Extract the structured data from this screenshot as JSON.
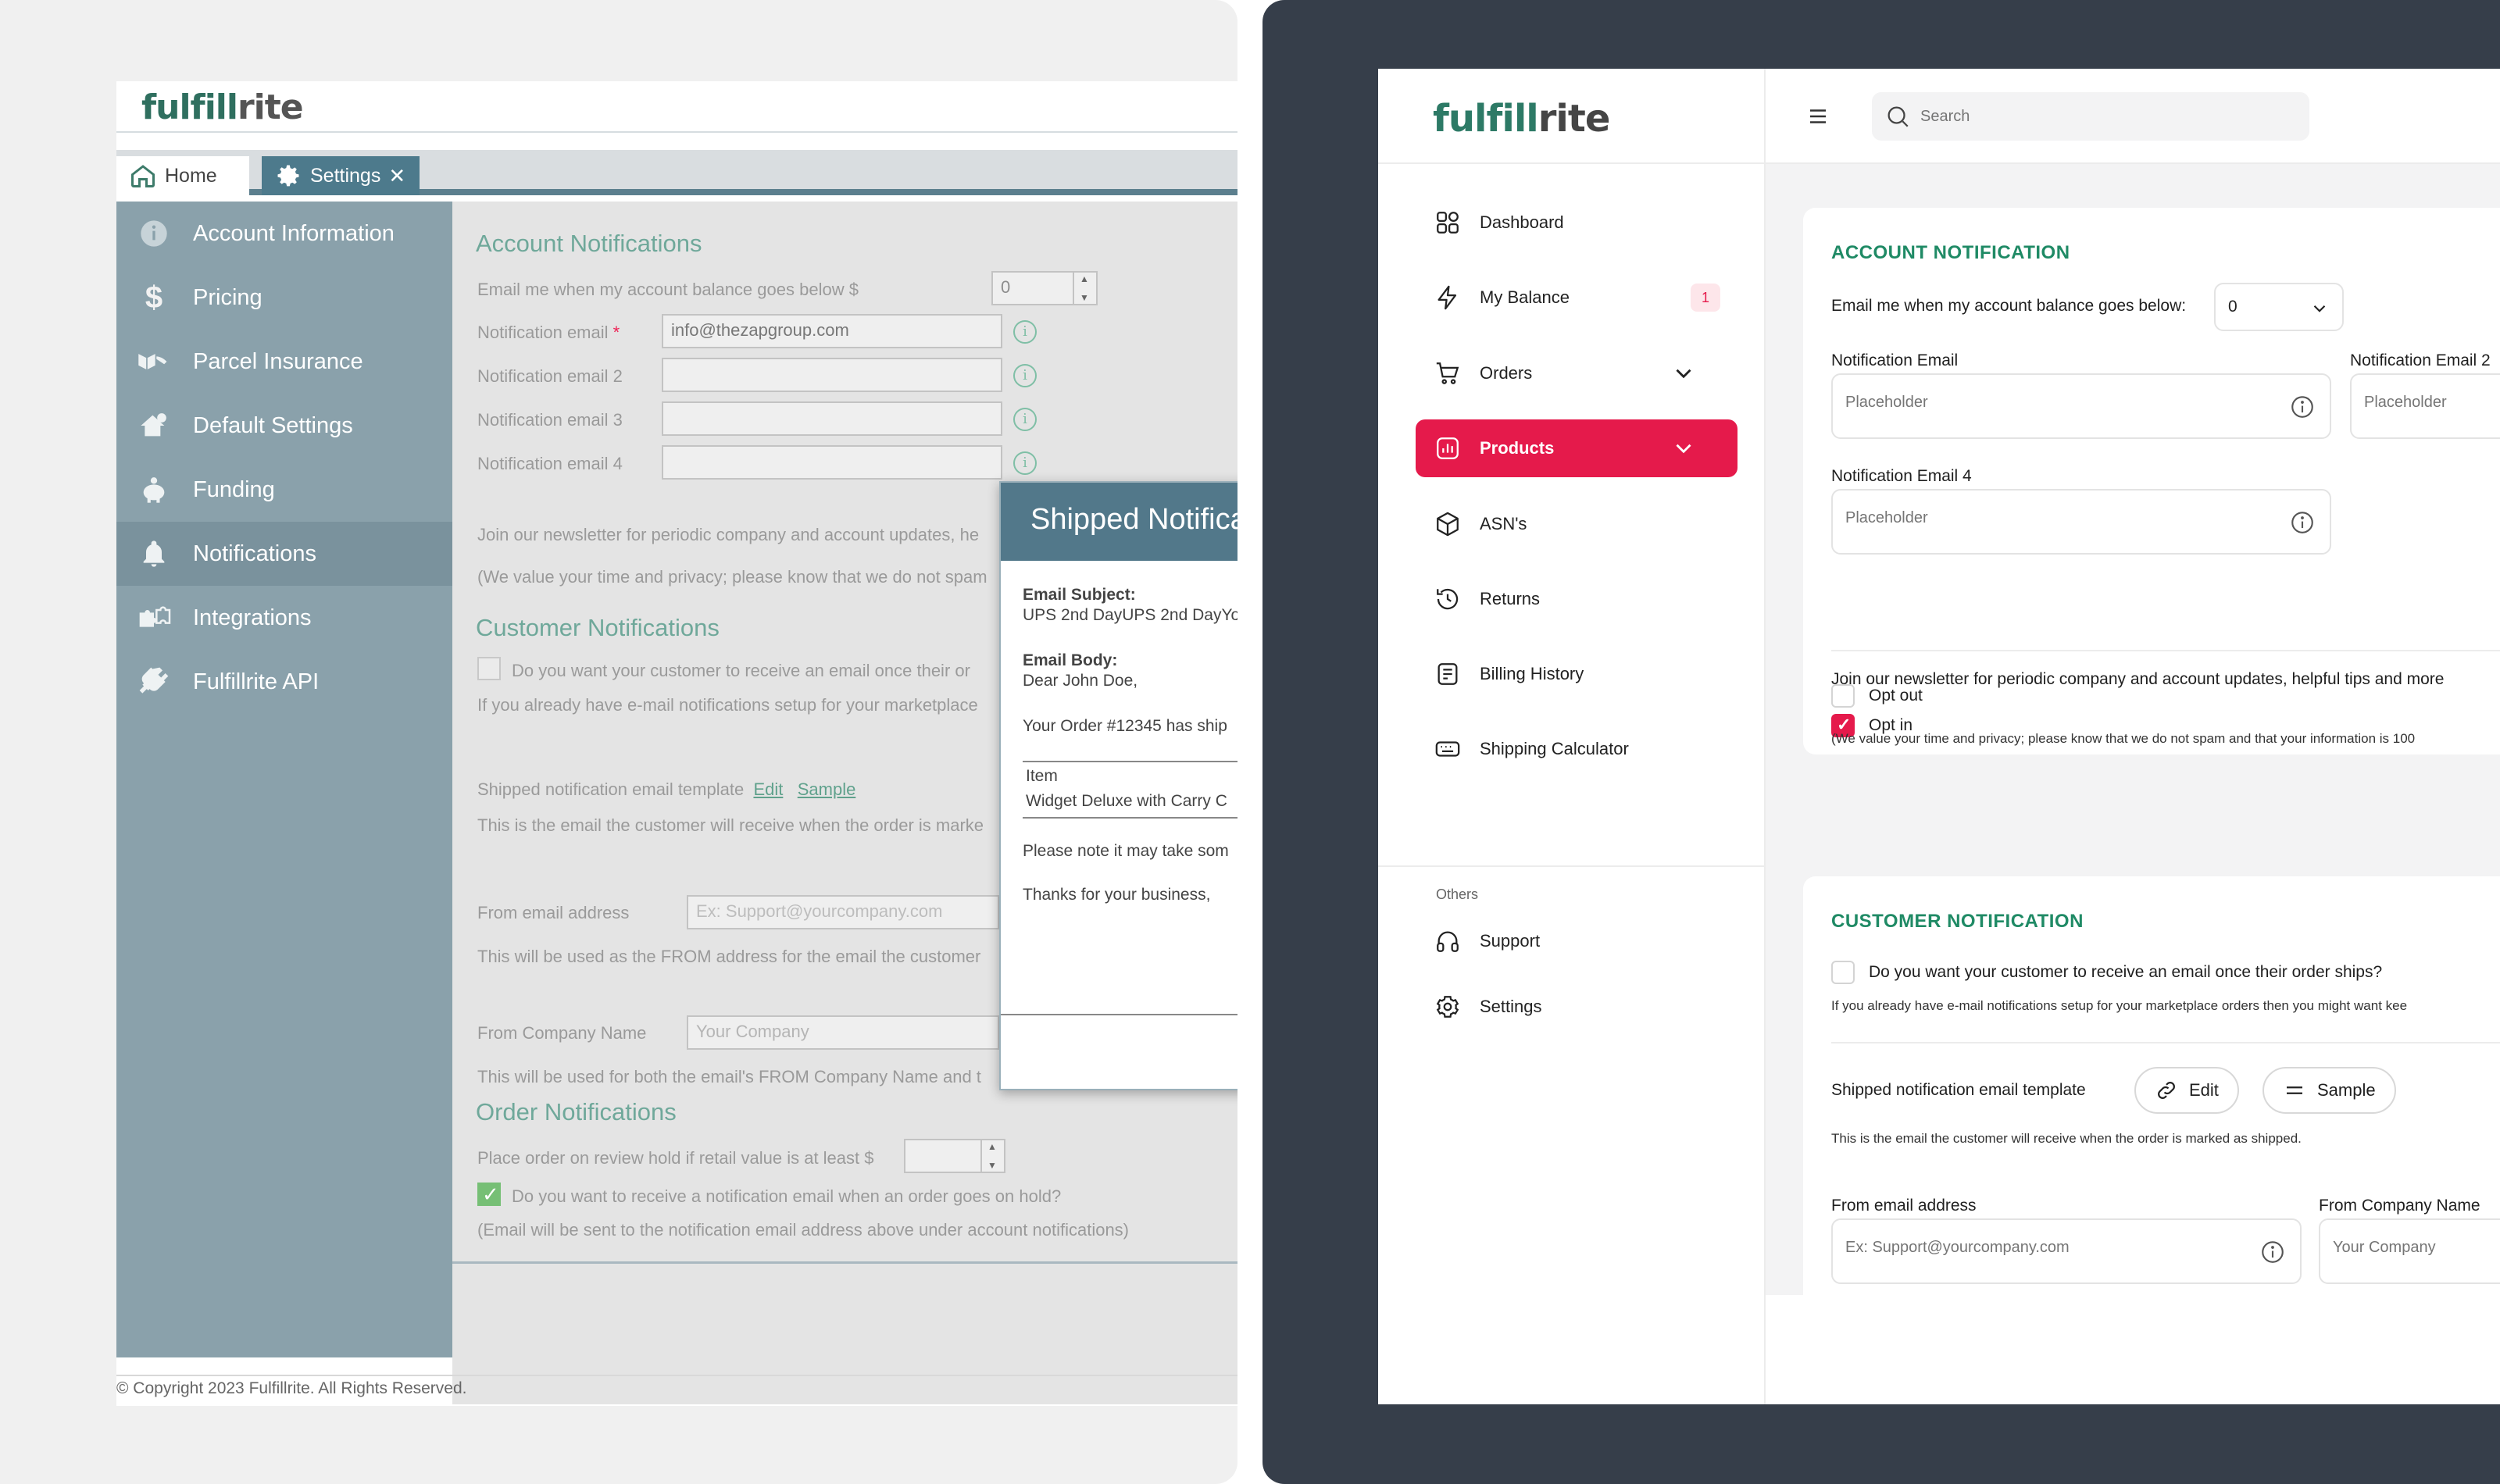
{
  "old_ui": {
    "logo": {
      "a": "fulfill",
      "b": "rite"
    },
    "tabs": {
      "home": "Home",
      "settings": "Settings"
    },
    "sidebar": [
      {
        "label": "Account Information",
        "icon": "info-icon"
      },
      {
        "label": "Pricing",
        "icon": "dollar-icon"
      },
      {
        "label": "Parcel Insurance",
        "icon": "parcel-insurance-icon"
      },
      {
        "label": "Default Settings",
        "icon": "house-gear-icon"
      },
      {
        "label": "Funding",
        "icon": "piggy-bank-icon"
      },
      {
        "label": "Notifications",
        "icon": "bell-icon"
      },
      {
        "label": "Integrations",
        "icon": "puzzle-icon"
      },
      {
        "label": "Fulfillrite API",
        "icon": "plug-icon"
      }
    ],
    "account": {
      "title": "Account Notifications",
      "balance_label": "Email me when my account balance goes below $",
      "balance_value": "0",
      "email_label": "Notification email",
      "email_required": "*",
      "email_value": "info@thezapgroup.com",
      "email2_label": "Notification email 2",
      "email3_label": "Notification email 3",
      "email4_label": "Notification email 4",
      "newsletter": "Join our newsletter for periodic company and account updates, he",
      "privacy": "(We value your time and privacy; please know that we do not spam"
    },
    "customer": {
      "title": "Customer Notifications",
      "question": "Do you want your customer to receive an email once their or",
      "setup_note": "If you already have e-mail notifications setup for your marketplace",
      "template_label": "Shipped notification email template",
      "edit": "Edit",
      "sample": "Sample",
      "template_note": "This is the email the customer will receive when the order is marke",
      "from_email_label": "From email address",
      "from_email_placeholder": "Ex: Support@yourcompany.com",
      "from_email_note": "This will be used as the FROM address for the email the customer",
      "from_company_label": "From Company Name",
      "from_company_placeholder": "Your Company",
      "from_company_note": "This will be used for both the email's FROM Company Name and t"
    },
    "order": {
      "title": "Order Notifications",
      "hold_label": "Place order on review hold if retail value is at least $",
      "hold_question": "Do you want to receive a notification email when an order goes on hold?",
      "hold_note": "(Email will be sent to the notification email address above under account notifications)"
    },
    "modal": {
      "title": "Shipped Notifica",
      "subject_label": "Email Subject:",
      "subject_value": "UPS 2nd DayUPS 2nd DayYo",
      "body_label": "Email Body:",
      "greeting": "Dear John Doe,",
      "order_line": "Your Order #12345 has ship",
      "item_label": "Item",
      "item_value": "Widget Deluxe with Carry C",
      "note": "Please note it may take som",
      "thanks": "Thanks for your business,"
    },
    "footer": "© Copyright 2023 Fulfillrite. All Rights Reserved."
  },
  "new_ui": {
    "logo": {
      "a": "fulfill",
      "b": "rite"
    },
    "search_placeholder": "Search",
    "nav": [
      {
        "label": "Dashboard",
        "icon": "grid-icon"
      },
      {
        "label": "My Balance",
        "icon": "lightning-icon",
        "badge": "1"
      },
      {
        "label": "Orders",
        "icon": "cart-icon"
      },
      {
        "label": "Products",
        "icon": "chart-icon"
      },
      {
        "label": "ASN's",
        "icon": "box-icon"
      },
      {
        "label": "Returns",
        "icon": "history-icon"
      },
      {
        "label": "Billing History",
        "icon": "receipt-icon"
      },
      {
        "label": "Shipping Calculator",
        "icon": "keyboard-icon"
      }
    ],
    "nav_section": "Others",
    "nav_others": [
      {
        "label": "Support",
        "icon": "headphones-icon"
      },
      {
        "label": "Settings",
        "icon": "gear-icon"
      }
    ],
    "account": {
      "title": "ACCOUNT NOTIFICATION",
      "balance_label": "Email me when my account balance goes below:",
      "balance_value": "0",
      "email_label": "Notification Email",
      "email2_label": "Notification Email 2",
      "email4_label": "Notification Email 4",
      "placeholder": "Placeholder",
      "newsletter": "Join our newsletter for periodic company and account updates, helpful tips and more",
      "opt_in": "Opt in",
      "opt_out": "Opt out",
      "privacy": "(We value your time and privacy; please know that we do not spam and that your information is 100"
    },
    "customer": {
      "title": "CUSTOMER NOTIFICATION",
      "question": "Do you want your customer to receive an email once their order ships?",
      "setup_note": "If you already have e-mail notifications setup for your marketplace orders then you might want kee",
      "template_label": "Shipped notification email template",
      "edit": "Edit",
      "sample": "Sample",
      "template_note": "This is the email the customer will receive when the order is marked as shipped.",
      "from_email_label": "From email address",
      "from_email_placeholder": "Ex: Support@yourcompany.com",
      "from_company_label": "From Company Name",
      "from_company_placeholder": "Your Company"
    }
  },
  "colors": {
    "accent_new": "#e51a4b",
    "green_new": "#1f8a65",
    "old_sidebar": "#8aa1ab",
    "old_tab": "#4d7a8c",
    "dark_bg": "#363e4a"
  }
}
